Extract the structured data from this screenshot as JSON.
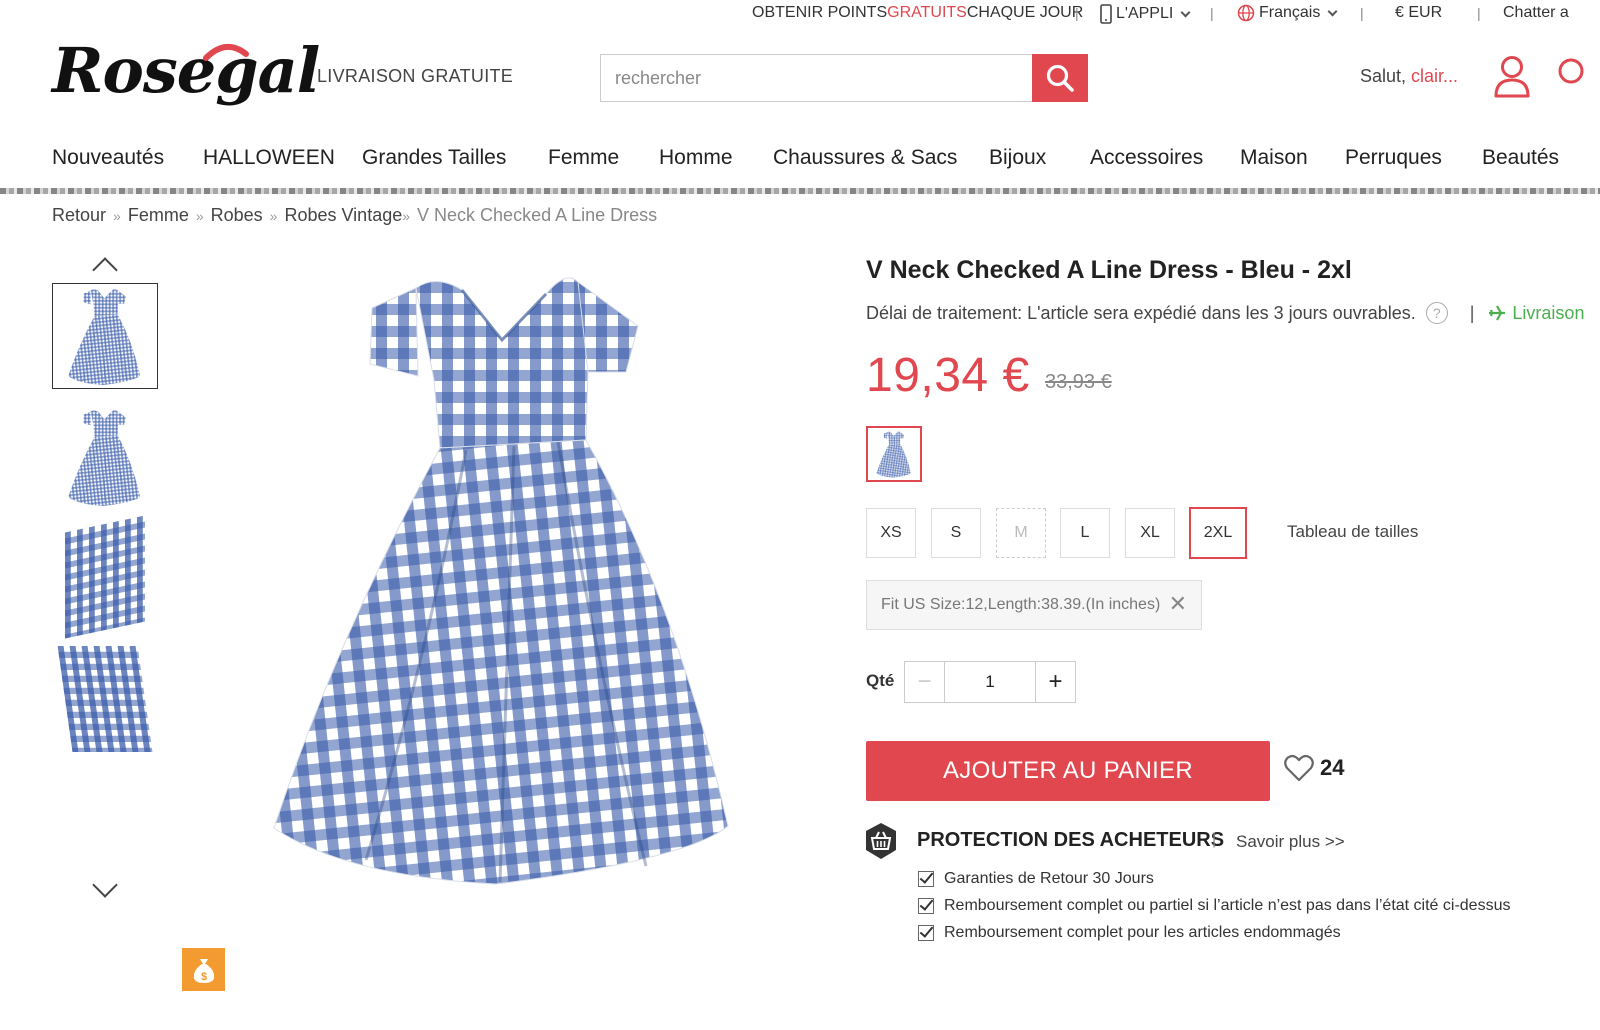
{
  "topbar": {
    "points_pre": "OBTENIR POINTS ",
    "points_highlight": "GRATUITS",
    "points_post": " CHAQUE JOUR",
    "app": "L'APPLI",
    "language": "Français",
    "currency": "€ EUR",
    "chat": "Chatter a"
  },
  "header": {
    "logo": "Rosegal",
    "tagline": "LIVRAISON GRATUITE",
    "search_placeholder": "rechercher",
    "greet_prefix": "Salut, ",
    "greet_name": "clair..."
  },
  "nav": [
    "Nouveautés",
    "HALLOWEEN",
    "Grandes Tailles",
    "Femme",
    "Homme",
    "Chaussures & Sacs",
    "Bijoux",
    "Accessoires",
    "Maison",
    "Perruques",
    "Beautés"
  ],
  "breadcrumb": {
    "items": [
      "Retour",
      "Femme",
      "Robes",
      "Robes Vintage"
    ],
    "current": "V Neck Checked A Line Dress"
  },
  "product": {
    "title": "V Neck Checked A Line Dress - Bleu - 2xl",
    "delay": "Délai de traitement: L'article sera expédié dans les 3 jours ouvrables.",
    "shipping": "Livraison",
    "price": "19,34 €",
    "old_price": "33,93 €",
    "sizes": [
      "XS",
      "S",
      "M",
      "L",
      "XL",
      "2XL"
    ],
    "size_chart": "Tableau de tailles",
    "fit": "Fit US Size:12,Length:38.39.(In inches)",
    "qty_label": "Qté",
    "qty": "1",
    "add_to_cart": "AJOUTER AU PANIER",
    "likes": "24"
  },
  "protection": {
    "title": "PROTECTION DES ACHETEURS",
    "more": "Savoir plus >>",
    "items": [
      "Garanties de Retour 30 Jours",
      "Remboursement complet ou partiel si l’article n’est pas dans l’état cité ci-dessus",
      "Remboursement complet pour les articles endommagés"
    ]
  },
  "colors": {
    "accent": "#e0474e",
    "ship_green": "#4bae4f",
    "coupon": "#f39a30",
    "dress_blue": "#3a5caa"
  }
}
